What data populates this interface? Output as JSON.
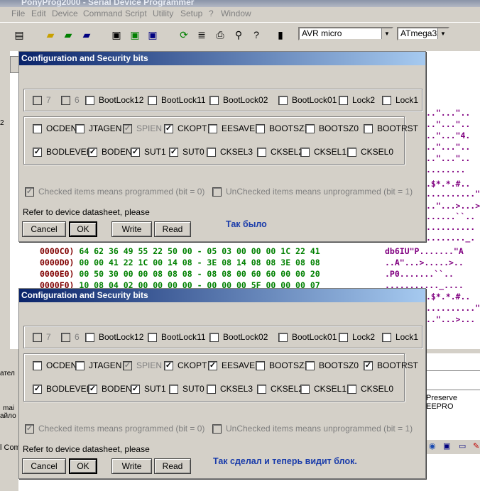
{
  "app": {
    "title": "PonyProg2000 - Serial Device Programmer",
    "menu": [
      "File",
      "Edit",
      "Device",
      "Command",
      "Script",
      "Utility",
      "Setup",
      "?",
      "Window"
    ],
    "device_family": "AVR micro",
    "device": "ATmega32",
    "hex_rows": [
      {
        "addr": "0000C0)",
        "bytes": "64 62 36 49 55 22 50 00 - 05 03 00 00 00 1C 22 41",
        "ascii": "db6IU\"P.......\"A"
      },
      {
        "addr": "0000D0)",
        "bytes": "00 00 41 22 1C 00 14 08 - 3E 08 14 08 08 3E 08 08",
        "ascii": "..A\"...>.....>.."
      },
      {
        "addr": "0000E0)",
        "bytes": "00 50 30 00 00 08 08 08 - 08 08 00 60 60 00 00 20",
        "ascii": ".P0.......``.. "
      },
      {
        "addr": "0000F0)",
        "bytes": "10 08 04 02 00 00 00 00 - 00 00 00 5F 00 00 00 07",
        "ascii": "..........._...."
      }
    ],
    "side_ascii": [
      "..\"...\"..",
      "..\"...\"..",
      "..\"...\"4.",
      "..\"...\"..",
      "..\"...\"..",
      "........",
      "...ББ.",
      ".$*.*.#..",
      "..........\"A",
      "..\"...>...>..",
      "......``..",
      "..........",
      "........_.",
      ".$*.*.#.."
    ],
    "side_ascii2": [
      ".$*.*.#..",
      "..........\"A",
      "..\"...>..."
    ],
    "preserve_label": "Preserve EEPRO",
    "left_fragments": [
      "2",
      "ател",
      "mai",
      "айло",
      "l Com"
    ]
  },
  "dialogs": [
    {
      "title": "Configuration and Security bits",
      "lock_bits": [
        {
          "label": "7",
          "checked": false,
          "disabled": true
        },
        {
          "label": "6",
          "checked": false,
          "disabled": true
        },
        {
          "label": "BootLock12",
          "checked": false,
          "disabled": false
        },
        {
          "label": "BootLock11",
          "checked": false,
          "disabled": false
        },
        {
          "label": "BootLock02",
          "checked": false,
          "disabled": false
        },
        {
          "label": "BootLock01",
          "checked": false,
          "disabled": false
        },
        {
          "label": "Lock2",
          "checked": false,
          "disabled": false
        },
        {
          "label": "Lock1",
          "checked": false,
          "disabled": false
        }
      ],
      "fuse_row1": [
        {
          "label": "OCDEN",
          "checked": false,
          "disabled": false
        },
        {
          "label": "JTAGEN",
          "checked": false,
          "disabled": false
        },
        {
          "label": "SPIEN",
          "checked": true,
          "disabled": true
        },
        {
          "label": "CKOPT",
          "checked": true,
          "disabled": false
        },
        {
          "label": "EESAVE",
          "checked": false,
          "disabled": false
        },
        {
          "label": "BOOTSZ1",
          "checked": false,
          "disabled": false
        },
        {
          "label": "BOOTSZ0",
          "checked": false,
          "disabled": false
        },
        {
          "label": "BOOTRST",
          "checked": false,
          "disabled": false
        }
      ],
      "fuse_row2": [
        {
          "label": "BODLEVEL",
          "checked": true,
          "disabled": false
        },
        {
          "label": "BODEN",
          "checked": true,
          "disabled": false
        },
        {
          "label": "SUT1",
          "checked": true,
          "disabled": false
        },
        {
          "label": "SUT0",
          "checked": true,
          "disabled": false
        },
        {
          "label": "CKSEL3",
          "checked": false,
          "disabled": false
        },
        {
          "label": "CKSEL2",
          "checked": false,
          "disabled": false
        },
        {
          "label": "CKSEL1",
          "checked": false,
          "disabled": false
        },
        {
          "label": "CKSEL0",
          "checked": false,
          "disabled": false
        }
      ],
      "legend_checked": "Checked items means programmed (bit = 0)",
      "legend_unchecked": "UnChecked items means unprogrammed (bit = 1)",
      "refer": "Refer to device datasheet, please",
      "buttons": {
        "cancel": "Cancel",
        "ok": "OK",
        "write": "Write",
        "read": "Read"
      },
      "annotation": "Так было"
    },
    {
      "title": "Configuration and Security bits",
      "lock_bits": [
        {
          "label": "7",
          "checked": false,
          "disabled": true
        },
        {
          "label": "6",
          "checked": false,
          "disabled": true
        },
        {
          "label": "BootLock12",
          "checked": false,
          "disabled": false
        },
        {
          "label": "BootLock11",
          "checked": false,
          "disabled": false
        },
        {
          "label": "BootLock02",
          "checked": false,
          "disabled": false
        },
        {
          "label": "BootLock01",
          "checked": false,
          "disabled": false
        },
        {
          "label": "Lock2",
          "checked": false,
          "disabled": false
        },
        {
          "label": "Lock1",
          "checked": false,
          "disabled": false
        }
      ],
      "fuse_row1": [
        {
          "label": "OCDEN",
          "checked": false,
          "disabled": false
        },
        {
          "label": "JTAGEN",
          "checked": false,
          "disabled": false
        },
        {
          "label": "SPIEN",
          "checked": true,
          "disabled": true
        },
        {
          "label": "CKOPT",
          "checked": true,
          "disabled": false
        },
        {
          "label": "EESAVE",
          "checked": true,
          "disabled": false
        },
        {
          "label": "BOOTSZ1",
          "checked": false,
          "disabled": false
        },
        {
          "label": "BOOTSZ0",
          "checked": false,
          "disabled": false
        },
        {
          "label": "BOOTRST",
          "checked": true,
          "disabled": false
        }
      ],
      "fuse_row2": [
        {
          "label": "BODLEVEL",
          "checked": true,
          "disabled": false
        },
        {
          "label": "BODEN",
          "checked": true,
          "disabled": false
        },
        {
          "label": "SUT1",
          "checked": true,
          "disabled": false
        },
        {
          "label": "SUT0",
          "checked": false,
          "disabled": false
        },
        {
          "label": "CKSEL3",
          "checked": false,
          "disabled": false
        },
        {
          "label": "CKSEL2",
          "checked": false,
          "disabled": false
        },
        {
          "label": "CKSEL1",
          "checked": false,
          "disabled": false
        },
        {
          "label": "CKSEL0",
          "checked": false,
          "disabled": false
        }
      ],
      "legend_checked": "Checked items means programmed (bit = 0)",
      "legend_unchecked": "UnChecked items means unprogrammed (bit = 1)",
      "refer": "Refer to device datasheet, please",
      "buttons": {
        "cancel": "Cancel",
        "ok": "OK",
        "write": "Write",
        "read": "Read"
      },
      "annotation": "Так сделал и теперь видит блок."
    }
  ]
}
